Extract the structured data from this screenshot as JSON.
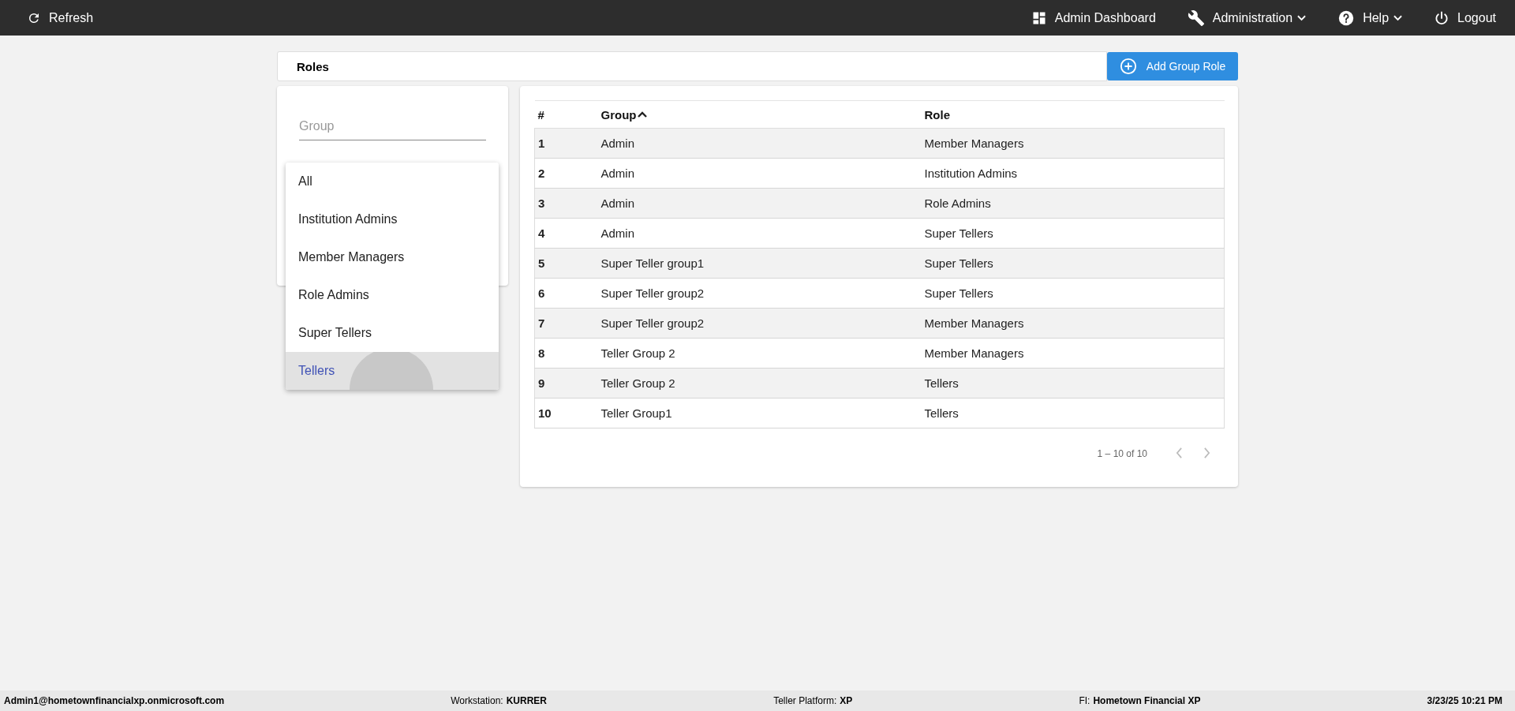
{
  "top_bar": {
    "refresh": "Refresh",
    "menu": [
      {
        "kind": "dashboard",
        "label": "Admin Dashboard",
        "dropdown": false
      },
      {
        "kind": "wrench",
        "label": "Administration",
        "dropdown": true
      },
      {
        "kind": "help",
        "label": "Help",
        "dropdown": true
      },
      {
        "kind": "power",
        "label": "Logout",
        "dropdown": false
      }
    ]
  },
  "page": {
    "title": "Roles",
    "add_button": "Add Group Role"
  },
  "filter": {
    "group_placeholder": "Group"
  },
  "role_dropdown": {
    "options": [
      {
        "label": "All",
        "selected": false
      },
      {
        "label": "Institution Admins",
        "selected": false
      },
      {
        "label": "Member Managers",
        "selected": false
      },
      {
        "label": "Role Admins",
        "selected": false
      },
      {
        "label": "Super Tellers",
        "selected": false
      },
      {
        "label": "Tellers",
        "selected": true
      }
    ]
  },
  "table": {
    "columns": [
      {
        "label": "#",
        "sorted": false
      },
      {
        "label": "Group",
        "sorted": true
      },
      {
        "label": "Role",
        "sorted": false
      }
    ],
    "rows": [
      [
        "1",
        "Admin",
        "Member Managers"
      ],
      [
        "2",
        "Admin",
        "Institution Admins"
      ],
      [
        "3",
        "Admin",
        "Role Admins"
      ],
      [
        "4",
        "Admin",
        "Super Tellers"
      ],
      [
        "5",
        "Super Teller group1",
        "Super Tellers"
      ],
      [
        "6",
        "Super Teller group2",
        "Super Tellers"
      ],
      [
        "7",
        "Super Teller group2",
        "Member Managers"
      ],
      [
        "8",
        "Teller Group 2",
        "Member Managers"
      ],
      [
        "9",
        "Teller Group 2",
        "Tellers"
      ],
      [
        "10",
        "Teller Group1",
        "Tellers"
      ]
    ]
  },
  "pagination": {
    "range": "1 – 10 of 10",
    "prev_disabled": true,
    "next_disabled": true
  },
  "status_bar": [
    {
      "value": "Admin1@hometownfinancialxp.onmicrosoft.com"
    },
    {
      "label": "Workstation:",
      "value": "KURRER"
    },
    {
      "label": "Teller Platform:",
      "value": "XP"
    },
    {
      "label": "FI:",
      "value": "Hometown Financial XP"
    },
    {
      "value": "3/23/25 10:21 PM"
    }
  ]
}
